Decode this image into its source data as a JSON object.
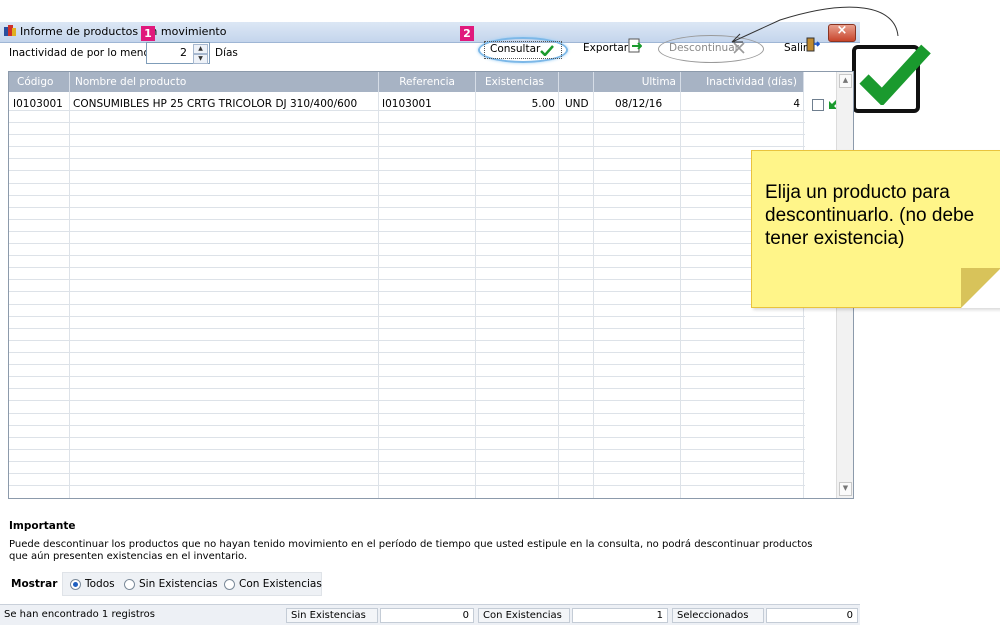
{
  "window": {
    "title": "Informe de productos sin movimiento"
  },
  "toolbar": {
    "inactivity_label": "Inactividad de por lo menos",
    "inactivity_value": "2",
    "days_label": "Días",
    "badge1": "1",
    "badge2": "2",
    "consultar_label": "Consultar",
    "exportar_label": "Exportar",
    "descontinuar_label": "Descontinuar",
    "salir_label": "Salir"
  },
  "table": {
    "headers": [
      "Código",
      "Nombre del producto",
      "Referencia",
      "Existencias",
      "",
      "Ultima actividad",
      "Inactividad (días)"
    ],
    "rows": [
      {
        "codigo": "I0103001",
        "nombre": "CONSUMIBLES HP 25 CRTG TRICOLOR DJ 310/400/600",
        "referencia": "I0103001",
        "existencias": "5.00",
        "unidad": "UND",
        "ultima": "08/12/16",
        "inactividad": "4"
      }
    ]
  },
  "importante": {
    "title": "Importante",
    "text": "Puede descontinuar los productos que no hayan tenido movimiento en el período de tiempo que usted estipule en la consulta, no podrá descontinuar productos que aún presenten existencias en el inventario."
  },
  "mostrar": {
    "label": "Mostrar",
    "options": [
      "Todos",
      "Sin Existencias",
      "Con Existencias"
    ],
    "selected": "Todos"
  },
  "status": {
    "found": "Se han encontrado 1 registros",
    "sin_label": "Sin Existencias",
    "sin_value": "0",
    "con_label": "Con Existencias",
    "con_value": "1",
    "sel_label": "Seleccionados",
    "sel_value": "0"
  },
  "note": {
    "text": "Elija un producto para descontinuarlo. (no debe tener existencia)"
  },
  "colors": {
    "badge": "#e0197c",
    "check_green": "#1a9a2e",
    "note_bg": "#fff589"
  }
}
